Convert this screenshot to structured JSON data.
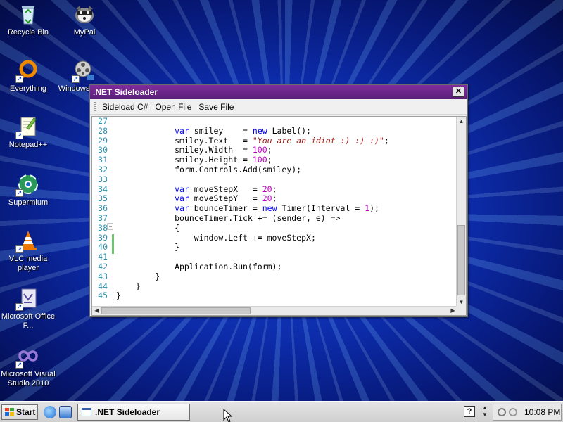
{
  "desktop": {
    "icons": [
      {
        "label": "Recycle Bin"
      },
      {
        "label": "MyPal"
      },
      {
        "label": "Everything"
      },
      {
        "label": "Windows Make"
      },
      {
        "label": "Notepad++"
      },
      {
        "label": "Supermium"
      },
      {
        "label": "VLC media player"
      },
      {
        "label": "Microsoft Office F..."
      },
      {
        "label": "Microsoft Visual Studio 2010"
      }
    ]
  },
  "window": {
    "title": ".NET Sideloader",
    "close_label": "✕",
    "menu": [
      "Sideload C#",
      "Open File",
      "Save File"
    ],
    "editor": {
      "line_numbers": [
        "27",
        "28",
        "29",
        "30",
        "31",
        "32",
        "33",
        "34",
        "35",
        "36",
        "37",
        "38",
        "39",
        "40",
        "41",
        "42",
        "43",
        "44",
        "45"
      ],
      "lines": [
        "",
        "            var smiley    = new Label();",
        "            smiley.Text   = \"You are an idiot :) :) :)\";",
        "            smiley.Width  = 100;",
        "            smiley.Height = 100;",
        "            form.Controls.Add(smiley);",
        "",
        "            var moveStepX   = 20;",
        "            var moveStepY   = 20;",
        "            var bounceTimer = new Timer(Interval = 1);",
        "            bounceTimer.Tick += (sender, e) =>",
        "            {",
        "                window.Left += moveStepX;",
        "            }",
        "",
        "            Application.Run(form);",
        "        }",
        "    }",
        "}"
      ]
    }
  },
  "taskbar": {
    "start_label": "Start",
    "task_label": ".NET Sideloader",
    "help_label": "?",
    "clock": "10:08 PM"
  },
  "colors": {
    "titlebar": "#6a2589",
    "keyword": "#0000ff",
    "string": "#a31515",
    "number": "#c000c0",
    "line_number": "#2b91af"
  }
}
